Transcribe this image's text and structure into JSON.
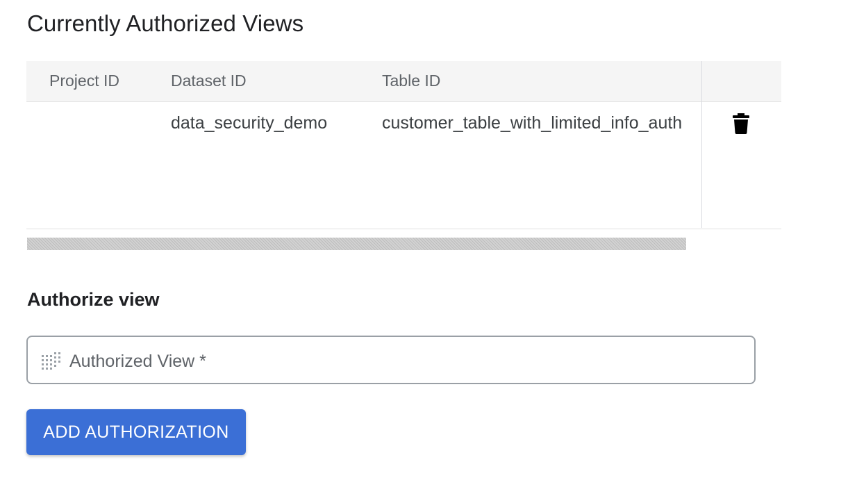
{
  "section_title": "Currently Authorized Views",
  "table": {
    "columns": [
      "Project ID",
      "Dataset ID",
      "Table ID"
    ],
    "rows": [
      {
        "project_id": "",
        "dataset_id": "data_security_demo",
        "table_id": "customer_table_with_limited_info_auth"
      }
    ]
  },
  "icons": {
    "delete": "trash-icon",
    "field": "dots-grid-icon"
  },
  "authorize": {
    "title": "Authorize view",
    "field_placeholder": "Authorized View *",
    "button_label": "ADD AUTHORIZATION"
  },
  "colors": {
    "primary_button": "#3b6fd6",
    "header_bg": "#f5f5f5"
  }
}
